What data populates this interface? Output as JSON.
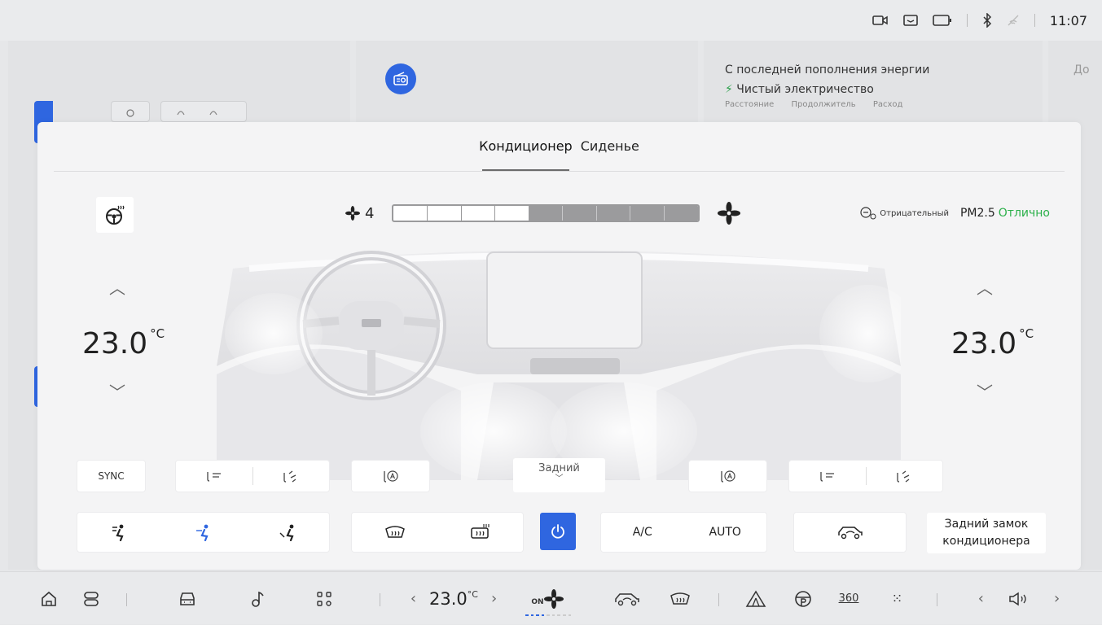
{
  "status_bar": {
    "time": "11:07"
  },
  "background": {
    "energy_title": "С последней пополнения энергии",
    "energy_type": "Чистый электричество",
    "energy_labels": "Расстояние Продолжитель Расход",
    "edge_text": "До"
  },
  "climate": {
    "tabs": {
      "active": "Кондиционер",
      "other": "Сиденье"
    },
    "fan_level": "4",
    "fan_fraction": 0.4,
    "fan_segments_total": 9,
    "fan_segments_on": 4,
    "air_quality": {
      "ion_label": "Отрицательный",
      "pm_label": "PM2.5",
      "pm_status": "Отлично",
      "pm_color": "#2bb04a"
    },
    "left_temp": {
      "value": "23.0",
      "unit": "°C"
    },
    "right_temp": {
      "value": "23.0",
      "unit": "°C"
    },
    "sync_label": "SYNC",
    "rear_label": "Задний",
    "ac_label": "A/C",
    "auto_label": "AUTO",
    "rear_lock_line1": "Задний замок",
    "rear_lock_line2": "кондиционера"
  },
  "dock": {
    "temp_value": "23.0",
    "temp_unit": "°C",
    "fan_prefix": "ON",
    "camera_label": "360"
  },
  "colors": {
    "accent": "#2f66e0",
    "green": "#2bb04a"
  }
}
